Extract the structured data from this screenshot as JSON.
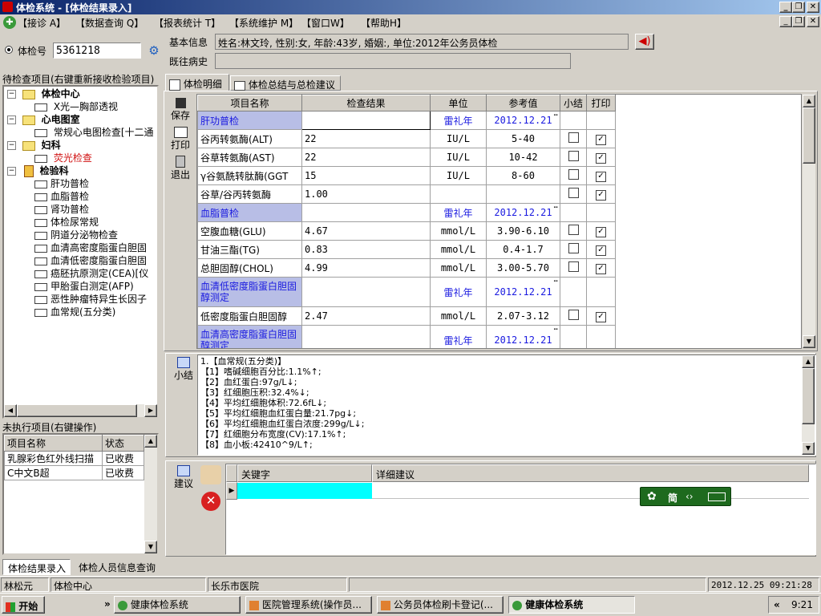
{
  "window": {
    "title": "体检系统 - [体检结果录入]"
  },
  "menu": [
    "【接诊 A】",
    "【数据查询 Q】",
    "【报表统计 T】",
    "【系统维护 M】",
    "【窗口W】",
    "【帮助H】"
  ],
  "exam": {
    "radio_label": "体检号",
    "exam_no": "5361218"
  },
  "basic_info": {
    "label": "基本信息",
    "value": "姓名:林文玲, 性别:女, 年龄:43岁, 婚姻:, 单位:2012年公务员体检"
  },
  "history": {
    "label": "既往病史",
    "value": ""
  },
  "tree": {
    "header": "待检查项目(右键重新接收检验项目)",
    "groups": [
      {
        "label": "体检中心",
        "items": [
          "X光—胸部透视"
        ]
      },
      {
        "label": "心电图室",
        "items": [
          "常规心电图检查[十二通"
        ]
      },
      {
        "label": "妇科",
        "items": [
          "荧光检查"
        ]
      },
      {
        "label": "检验科",
        "items": [
          "肝功普检",
          "血脂普检",
          "肾功普检",
          "体检尿常规",
          "阴道分泌物检查",
          "血清高密度脂蛋白胆固",
          "血清低密度脂蛋白胆固",
          "癌胚抗原测定(CEA)[仪",
          "甲胎蛋白测定(AFP)",
          "恶性肿瘤特异生长因子",
          "血常规(五分类)"
        ]
      }
    ]
  },
  "pending": {
    "header": "未执行项目(右键操作)",
    "columns": [
      "项目名称",
      "状态"
    ],
    "rows": [
      [
        "乳腺彩色红外线扫描",
        "已收费"
      ],
      [
        "C中文B超",
        "已收费"
      ]
    ]
  },
  "tabs": [
    "体检明细",
    "体检总结与总检建议"
  ],
  "side_buttons": {
    "save": "保存",
    "print": "打印",
    "exit": "退出"
  },
  "results": {
    "columns": [
      "项目名称",
      "检查结果",
      "单位",
      "参考值",
      "小结",
      "打印"
    ],
    "rows": [
      {
        "name": "肝功普检",
        "result": "",
        "unit": "雷礼年",
        "ref": "2012.12.21",
        "cat": true
      },
      {
        "name": "谷丙转氨酶(ALT)",
        "result": "22",
        "unit": "IU/L",
        "ref": "5-40",
        "sum": false,
        "print": true
      },
      {
        "name": "谷草转氨酶(AST)",
        "result": "22",
        "unit": "IU/L",
        "ref": "10-42",
        "sum": false,
        "print": true
      },
      {
        "name": "γ谷氨酰转肽酶(GGT",
        "result": "15",
        "unit": "IU/L",
        "ref": "8-60",
        "sum": false,
        "print": true
      },
      {
        "name": "谷草/谷丙转氨酶",
        "result": "1.00",
        "unit": "",
        "ref": "",
        "sum": false,
        "print": true
      },
      {
        "name": "血脂普检",
        "result": "",
        "unit": "雷礼年",
        "ref": "2012.12.21",
        "cat": true
      },
      {
        "name": "空腹血糖(GLU)",
        "result": "4.67",
        "unit": "mmol/L",
        "ref": "3.90-6.10",
        "sum": false,
        "print": true
      },
      {
        "name": "甘油三酯(TG)",
        "result": "0.83",
        "unit": "mmol/L",
        "ref": "0.4-1.7",
        "sum": false,
        "print": true
      },
      {
        "name": "总胆固醇(CHOL)",
        "result": "4.99",
        "unit": "mmol/L",
        "ref": "3.00-5.70",
        "sum": false,
        "print": true
      },
      {
        "name": "血清低密度脂蛋白胆固醇测定",
        "result": "",
        "unit": "雷礼年",
        "ref": "2012.12.21",
        "cat": true,
        "tall": true
      },
      {
        "name": "低密度脂蛋白胆固醇",
        "result": "2.47",
        "unit": "mmol/L",
        "ref": "2.07-3.12",
        "sum": false,
        "print": true
      },
      {
        "name": "血清高密度脂蛋白胆固醇测定",
        "result": "",
        "unit": "雷礼年",
        "ref": "2012.12.21",
        "cat": true,
        "tall": true
      }
    ]
  },
  "summary": {
    "label": "小结",
    "lines": [
      "1.【血常规(五分类)】",
      "【1】嗜碱细胞百分比:1.1%↑;",
      "【2】血红蛋白:97g/L↓;",
      "【3】红细胞压积:32.4%↓;",
      "【4】平均红细胞体积:72.6fL↓;",
      "【5】平均红细胞血红蛋白量:21.7pg↓;",
      "【6】平均红细胞血红蛋白浓度:299g/L↓;",
      "【7】红细胞分布宽度(CV):17.1%↑;",
      "【8】血小板:42410^9/L↑;"
    ]
  },
  "advice": {
    "label": "建议",
    "columns": [
      "关键字",
      "详细建议"
    ]
  },
  "ime": {
    "label": "简"
  },
  "bottom_tabs": [
    "体检结果录入",
    "体检人员信息查询"
  ],
  "status": {
    "user": "林松元",
    "dept": "体检中心",
    "hospital": "长乐市医院",
    "datetime": "2012.12.25 09:21:28"
  },
  "taskbar": {
    "start": "开始",
    "tasks": [
      "健康体检系统",
      "医院管理系统(操作员...",
      "公务员体检刷卡登记(...",
      "健康体检系统"
    ],
    "clock": "9:21"
  }
}
